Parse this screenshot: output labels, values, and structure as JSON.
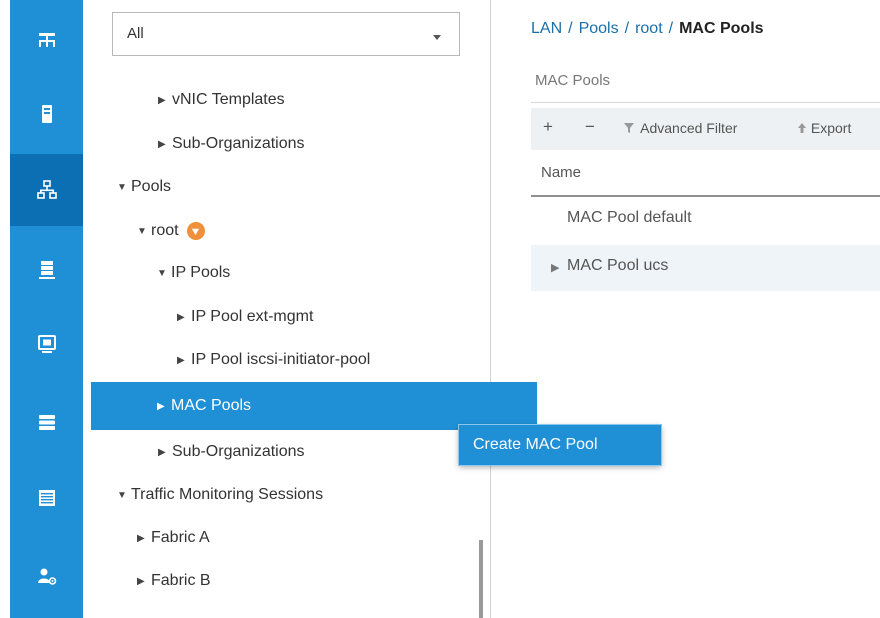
{
  "filter": {
    "value": "All"
  },
  "rail": {
    "icons": [
      "equipment-icon",
      "servers-icon",
      "lan-icon",
      "san-icon",
      "vm-icon",
      "storage-icon",
      "chassis-icon",
      "admin-icon"
    ]
  },
  "tree": {
    "items": [
      {
        "label": "vNIC Templates"
      },
      {
        "label": "Sub-Organizations"
      },
      {
        "label": "Pools"
      },
      {
        "label": "root"
      },
      {
        "label": "IP Pools"
      },
      {
        "label": "IP Pool ext-mgmt"
      },
      {
        "label": "IP Pool iscsi-initiator-pool"
      },
      {
        "label": "MAC Pools"
      },
      {
        "label": "Sub-Organizations"
      },
      {
        "label": "Traffic Monitoring Sessions"
      },
      {
        "label": "Fabric A"
      },
      {
        "label": "Fabric B"
      }
    ]
  },
  "context_menu": {
    "item": "Create MAC Pool"
  },
  "breadcrumb": {
    "lan": "LAN",
    "pools": "Pools",
    "root": "root",
    "current": "MAC Pools",
    "separator": "/"
  },
  "panel": {
    "title": "MAC Pools"
  },
  "toolbar": {
    "add": "+",
    "remove": "−",
    "advanced_filter": "Advanced Filter",
    "export": "Export"
  },
  "table": {
    "header_name": "Name",
    "rows": [
      {
        "name": "MAC Pool default"
      },
      {
        "name": "MAC Pool ucs"
      }
    ]
  },
  "colors": {
    "accent": "#1f8fd6",
    "rail_active": "#0d6fb3",
    "badge": "#f0903a",
    "link": "#1a6fa8"
  }
}
